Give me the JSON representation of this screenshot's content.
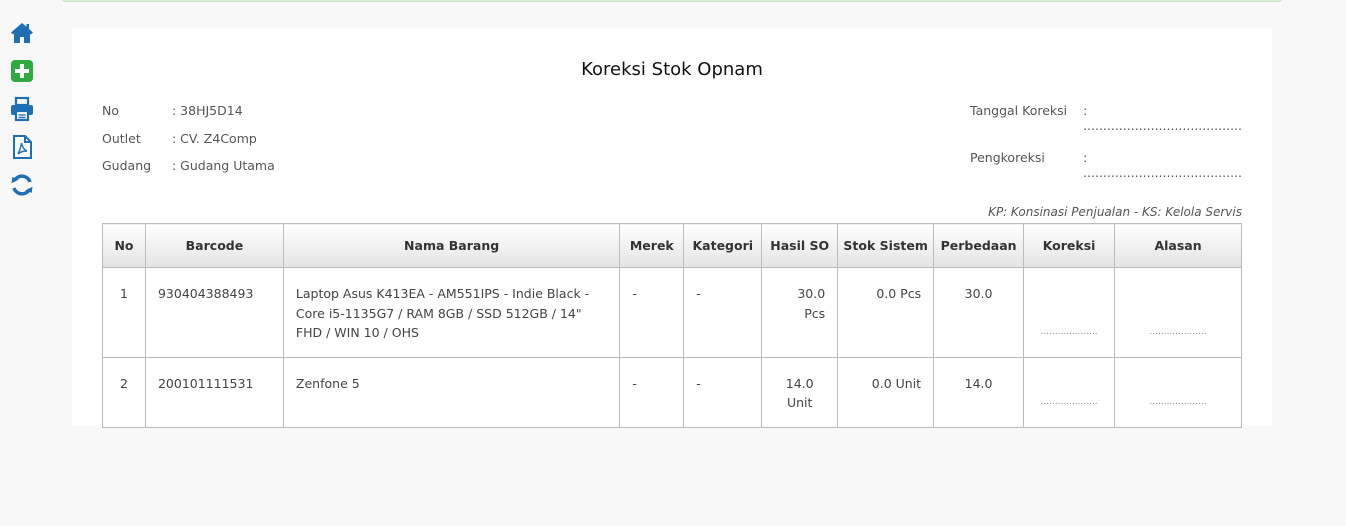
{
  "toolbar": {
    "home_icon": "home-icon",
    "add_icon": "plus-square-icon",
    "print_icon": "printer-icon",
    "pdf_icon": "pdf-file-icon",
    "refresh_icon": "refresh-icon",
    "accent": "#1f6fb5",
    "add_color": "#2eaa3f"
  },
  "document": {
    "title": "Koreksi Stok Opnam",
    "meta_left": [
      {
        "label": "No",
        "value": ": 38HJ5D14"
      },
      {
        "label": "Outlet",
        "value": ": CV. Z4Comp"
      },
      {
        "label": "Gudang",
        "value": ": Gudang Utama"
      }
    ],
    "meta_right": [
      {
        "label": "Tanggal Koreksi",
        "value": ": ........................................"
      },
      {
        "label": "Pengkoreksi",
        "value": ": ........................................"
      }
    ],
    "legend_note": "KP: Konsinasi Penjualan - KS: Kelola Servis"
  },
  "table": {
    "headers": [
      "No",
      "Barcode",
      "Nama Barang",
      "Merek",
      "Kategori",
      "Hasil SO",
      "Stok Sistem",
      "Perbedaan",
      "Koreksi",
      "Alasan"
    ],
    "rows": [
      {
        "no": "1",
        "barcode": "930404388493",
        "nama": "Laptop Asus K413EA - AM551IPS - Indie Black - Core i5-1135G7 / RAM 8GB / SSD 512GB / 14\" FHD / WIN 10 / OHS",
        "merek": "-",
        "kategori": "-",
        "hasil_so": "30.0 Pcs",
        "stok_sistem": "0.0 Pcs",
        "perbedaan": "30.0",
        "koreksi": "....................",
        "alasan": "...................."
      },
      {
        "no": "2",
        "barcode": "200101111531",
        "nama": "Zenfone 5",
        "merek": "-",
        "kategori": "-",
        "hasil_so": "14.0 Unit",
        "stok_sistem": "0.0 Unit",
        "perbedaan": "14.0",
        "koreksi": "....................",
        "alasan": "...................."
      }
    ]
  }
}
